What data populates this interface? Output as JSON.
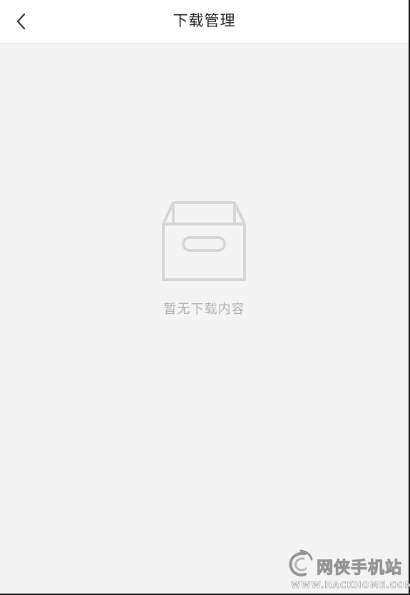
{
  "header": {
    "title": "下载管理",
    "back_icon": "chevron-left-icon"
  },
  "empty_state": {
    "icon": "empty-box-icon",
    "message": "暂无下载内容"
  },
  "watermark": {
    "site_name": "网侠手机站",
    "url": "WWW.HACKHOME.COM"
  },
  "colors": {
    "background": "#f4f4f5",
    "header_background": "#ffffff",
    "title_text": "#222222",
    "empty_icon": "#d6d6d6",
    "empty_text": "#b3b3b3"
  }
}
